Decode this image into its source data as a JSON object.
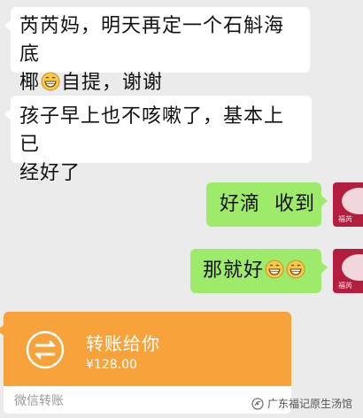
{
  "messages": [
    {
      "side": "left",
      "line1": "芮芮妈，明天再定一个石斛海底",
      "line2_before_emoji": "椰",
      "line2_after_emoji": "自提，谢谢",
      "emoji": "grinning-face"
    },
    {
      "side": "left",
      "line1": "孩子早上也不咳嗽了，基本上已",
      "line2": "经好了"
    },
    {
      "side": "right",
      "text": "好滴  收到"
    },
    {
      "side": "right",
      "text": "那就好",
      "emojis": [
        "grinning-face",
        "grinning-face"
      ]
    }
  ],
  "avatar_label": "福芮",
  "transfer": {
    "title": "转账给你",
    "amount": "¥128.00",
    "label": "微信转账",
    "accent": "#f7a23a"
  },
  "watermark": {
    "text": "广东福记原生汤馆",
    "icon": "wechat-official-account-icon"
  },
  "colors": {
    "background": "#ebebeb",
    "bubble_left": "#ffffff",
    "bubble_right": "#9eea6a",
    "transfer": "#f7a23a"
  }
}
